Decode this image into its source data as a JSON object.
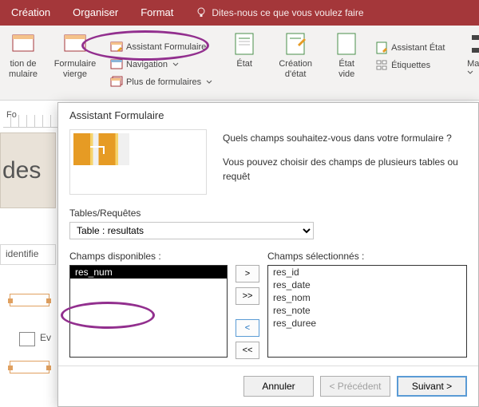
{
  "tabs": {
    "creation": "Création",
    "organiser": "Organiser",
    "format": "Format",
    "tellme": "Dites-nous ce que vous voulez faire"
  },
  "ribbon": {
    "tion_de": "tion de",
    "mulaire": "mulaire",
    "formulaire_vierge_l1": "Formulaire",
    "formulaire_vierge_l2": "vierge",
    "assistant_formulaire": "Assistant Formulaire",
    "navigation": "Navigation",
    "plus_de_formulaires": "Plus de formulaires",
    "etat": "État",
    "creation_etat_l1": "Création",
    "creation_etat_l2": "d'état",
    "etat_vide_l1": "État",
    "etat_vide_l2": "vide",
    "assistant_etat": "Assistant État",
    "etiquettes": "Étiquettes",
    "macro": "Macro"
  },
  "bg": {
    "fo": "Fo",
    "des": "des",
    "identifier": "identifie",
    "ev": "Ev"
  },
  "dialog": {
    "title": "Assistant Formulaire",
    "intro1": "Quels champs souhaitez-vous dans votre formulaire ?",
    "intro2": "Vous pouvez choisir des champs de plusieurs tables ou requêt",
    "tables_label": "Tables/Requêtes",
    "table_selected": "Table : resultats",
    "available_label": "Champs disponibles :",
    "selected_label": "Champs sélectionnés :",
    "available": [
      "res_num"
    ],
    "selected": [
      "res_id",
      "res_date",
      "res_nom",
      "res_note",
      "res_duree"
    ],
    "move_add": ">",
    "move_add_all": ">>",
    "move_remove": "<",
    "move_remove_all": "<<",
    "btn_cancel": "Annuler",
    "btn_prev": "< Précédent",
    "btn_next": "Suivant >"
  }
}
